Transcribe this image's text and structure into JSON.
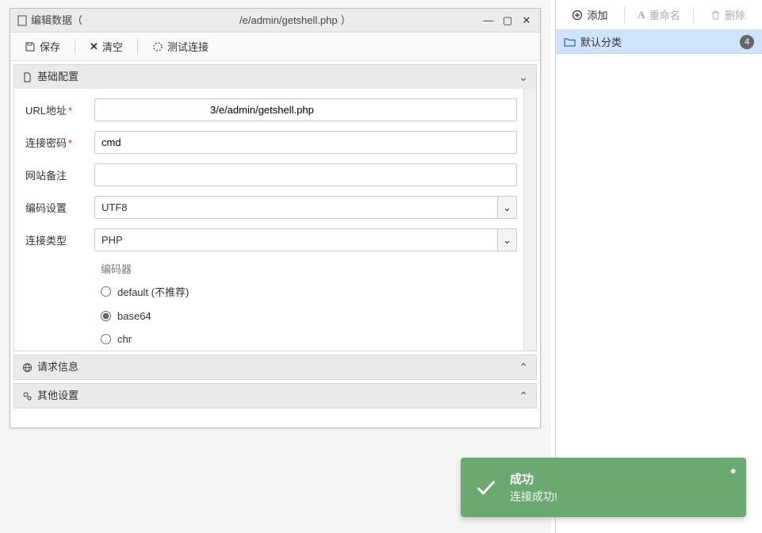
{
  "window": {
    "title_prefix": "编辑数据（",
    "title_path": "/e/admin/getshell.php",
    "title_suffix": "）",
    "toolbar": {
      "save": "保存",
      "clear": "清空",
      "test": "测试连接"
    }
  },
  "accordion": {
    "basic": "基础配置",
    "request": "请求信息",
    "other": "其他设置"
  },
  "form": {
    "url_label": "URL地址",
    "url_value": "3/e/admin/getshell.php",
    "pwd_label": "连接密码",
    "pwd_value": "cmd",
    "note_label": "网站备注",
    "note_value": "",
    "encode_label": "编码设置",
    "encode_value": "UTF8",
    "type_label": "连接类型",
    "type_value": "PHP",
    "encoder_group": "编码器",
    "enc_default": "default (不推荐)",
    "enc_base64": "base64",
    "enc_chr": "chr"
  },
  "right": {
    "add": "添加",
    "rename": "重命名",
    "delete": "删除",
    "category": "默认分类",
    "count": "4"
  },
  "toast": {
    "title": "成功",
    "body": "连接成功!"
  }
}
